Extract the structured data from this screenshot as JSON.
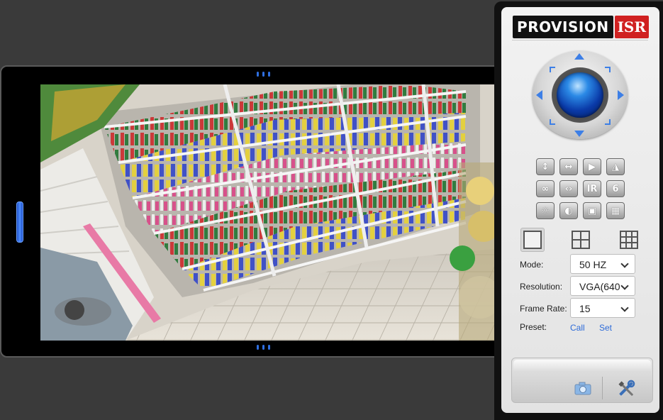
{
  "brand": {
    "logo_main": "PROVISION",
    "logo_accent": "ISR"
  },
  "video": {
    "scene": "retail store aisle with shelves"
  },
  "ptz": {
    "icons": [
      "arrow-up-icon",
      "arrow-down-icon",
      "arrow-left-icon",
      "arrow-right-icon",
      "lens-icon"
    ]
  },
  "controls": {
    "buttons": [
      {
        "name": "flip-vertical-button",
        "glyph": "↕"
      },
      {
        "name": "flip-horizontal-button",
        "glyph": "↔"
      },
      {
        "name": "mirror-play-button",
        "glyph": "▶"
      },
      {
        "name": "mirror-button",
        "glyph": "◮"
      },
      {
        "name": "loop-button",
        "glyph": "∞"
      },
      {
        "name": "code-button",
        "glyph": "‹›"
      },
      {
        "name": "ir-button",
        "glyph": "IR"
      },
      {
        "name": "six-button",
        "glyph": "6"
      },
      {
        "name": "brightness-button",
        "glyph": "☼"
      },
      {
        "name": "contrast-button",
        "glyph": "◐"
      },
      {
        "name": "picture-button",
        "glyph": "▣"
      },
      {
        "name": "color-button",
        "glyph": "▦"
      }
    ]
  },
  "form": {
    "mode_label": "Mode:",
    "mode_value": "50 HZ",
    "resolution_label": "Resolution:",
    "resolution_value": "VGA(640",
    "framerate_label": "Frame Rate:",
    "framerate_value": "15",
    "preset_label": "Preset:",
    "preset_call": "Call",
    "preset_set": "Set"
  },
  "colors": {
    "accent": "#2d6bd8",
    "brand_red": "#d02020",
    "panel_bg": "#eeeeee"
  }
}
